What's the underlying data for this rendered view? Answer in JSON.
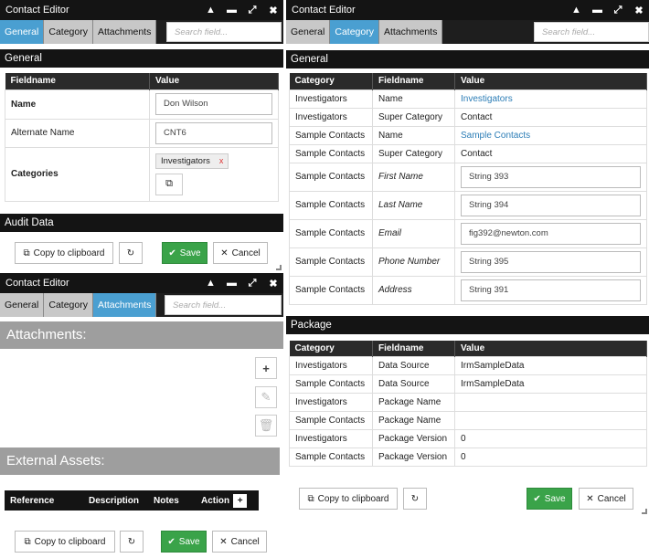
{
  "general_editor": {
    "title": "Contact Editor",
    "window_controls": [
      "▲",
      "▬",
      "⤢",
      "✖"
    ],
    "tabs": [
      "General",
      "Category",
      "Attachments"
    ],
    "search_placeholder": "Search field...",
    "section_general": "General",
    "col_fieldname": "Fieldname",
    "col_value": "Value",
    "rows": [
      {
        "label": "Name",
        "value": "Don Wilson"
      },
      {
        "label": "Alternate Name",
        "value": "CNT6"
      },
      {
        "label": "Categories",
        "tag": "Investigators",
        "tag_remove": "x"
      }
    ],
    "section_audit": "Audit Data",
    "copy_label": "Copy to clipboard",
    "save_label": "Save",
    "cancel_label": "Cancel"
  },
  "attachments_editor": {
    "title": "Contact Editor",
    "tabs": [
      "General",
      "Category",
      "Attachments"
    ],
    "search_placeholder": "Search field...",
    "attachments_header": "Attachments:",
    "external_header": "External Assets:",
    "columns": [
      "Reference",
      "Description",
      "Notes",
      "Action"
    ],
    "copy_label": "Copy to clipboard",
    "save_label": "Save",
    "cancel_label": "Cancel"
  },
  "category_editor": {
    "title": "Contact Editor",
    "tabs": [
      "General",
      "Category",
      "Attachments"
    ],
    "search_placeholder": "Search field...",
    "section_general": "General",
    "columns": [
      "Category",
      "Fieldname",
      "Value"
    ],
    "rows": [
      {
        "category": "Investigators",
        "field": "Name",
        "value": "Investigators",
        "type": "link"
      },
      {
        "category": "Investigators",
        "field": "Super Category",
        "value": "Contact",
        "type": "text"
      },
      {
        "category": "Sample Contacts",
        "field": "Name",
        "value": "Sample Contacts",
        "type": "link"
      },
      {
        "category": "Sample Contacts",
        "field": "Super Category",
        "value": "Contact",
        "type": "text"
      },
      {
        "category": "Sample Contacts",
        "field": "First Name",
        "value": "String 393",
        "type": "input"
      },
      {
        "category": "Sample Contacts",
        "field": "Last Name",
        "value": "String 394",
        "type": "input"
      },
      {
        "category": "Sample Contacts",
        "field": "Email",
        "value": "fig392@newton.com",
        "type": "input"
      },
      {
        "category": "Sample Contacts",
        "field": "Phone Number",
        "value": "String 395",
        "type": "input"
      },
      {
        "category": "Sample Contacts",
        "field": "Address",
        "value": "String 391",
        "type": "input"
      }
    ],
    "section_package": "Package",
    "package_rows": [
      {
        "category": "Investigators",
        "field": "Data Source",
        "value": "IrmSampleData"
      },
      {
        "category": "Sample Contacts",
        "field": "Data Source",
        "value": "IrmSampleData"
      },
      {
        "category": "Investigators",
        "field": "Package Name",
        "value": ""
      },
      {
        "category": "Sample Contacts",
        "field": "Package Name",
        "value": ""
      },
      {
        "category": "Investigators",
        "field": "Package Version",
        "value": "0"
      },
      {
        "category": "Sample Contacts",
        "field": "Package Version",
        "value": "0"
      }
    ],
    "copy_label": "Copy to clipboard",
    "save_label": "Save",
    "cancel_label": "Cancel"
  },
  "colors": {
    "accent": "#4a9fd1",
    "save_green": "#3aa349",
    "titlebar": "#141414",
    "link": "#2c7db6"
  }
}
